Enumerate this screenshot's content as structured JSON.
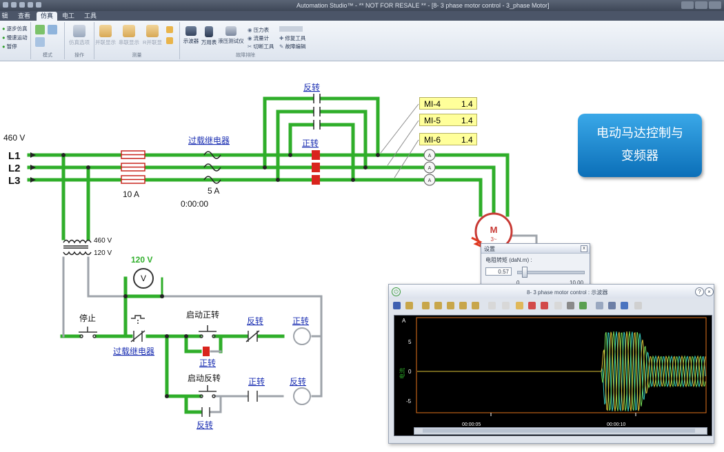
{
  "app": {
    "title": "Automation Studio™ - ** NOT FOR RESALE ** - [8- 3 phase motor control - 3_phase Motor]"
  },
  "menu_tabs": [
    "辑",
    "查看",
    "仿真",
    "电工",
    "工具"
  ],
  "menu_active": "仿真",
  "ribbon": {
    "sim_controls": [
      "逐步仿真",
      "慢速运动",
      "暂停"
    ],
    "group_mode": "模式",
    "group_operate": "操作",
    "operate_item": "仿真选项",
    "measure_items": [
      "并联显示",
      "串联显示",
      "R并联显"
    ],
    "group_measure": "测量",
    "instruments": [
      "示波器",
      "万用表",
      "液压测试仪"
    ],
    "small_tools": [
      "压力表",
      "流量计",
      "切断工具",
      "修复工具",
      "故障编辑"
    ],
    "group_troubleshoot": "故障排除"
  },
  "circuit": {
    "voltage_supply": "460 V",
    "lines": [
      "L1",
      "L2",
      "L3"
    ],
    "fuse_rating": "10 A",
    "overload_relay_label": "过载继电器",
    "overload_rating": "5 A",
    "timer": "0:00:00",
    "reverse_label": "反转",
    "forward_label": "正转",
    "transformer_primary": "460 V",
    "transformer_secondary": "120 V",
    "voltmeter_reading": "120 V",
    "voltmeter_symbol": "V",
    "stop_label": "停止",
    "start_forward_label": "启动正转",
    "start_reverse_label": "启动反转",
    "motor_symbol": "M",
    "motor_phase": "3~"
  },
  "meters": [
    {
      "name": "MI-4",
      "value": "1.4"
    },
    {
      "name": "MI-5",
      "value": "1.4"
    },
    {
      "name": "MI-6",
      "value": "1.4"
    }
  ],
  "panel_title": "电动马达控制与\n变频器",
  "panel_lines": [
    "电动马达控制与",
    "变频器"
  ],
  "settings_dialog": {
    "title": "设置",
    "param_label": "电阻转矩 (daN.m) :",
    "value": "0.57",
    "min": "0",
    "max": "10.00",
    "slider_fraction": 0.057
  },
  "scope": {
    "title": "8- 3 phase motor control : 示波器",
    "unit": "A",
    "y_axis_label": "电流",
    "y_ticks": [
      "5",
      "0",
      "-5"
    ],
    "x_ticks": [
      "00:00:05",
      "00:00:10"
    ],
    "colors": {
      "trace1": "#e2c83a",
      "trace2": "#39d3c6",
      "trace3": "#76e05a",
      "axis": "#e3731c"
    }
  },
  "colors": {
    "energized": "#2fae2a",
    "deenergized": "#9ea3aa",
    "contact_red": "#d9241d",
    "link_blue": "#1b2fb2"
  }
}
